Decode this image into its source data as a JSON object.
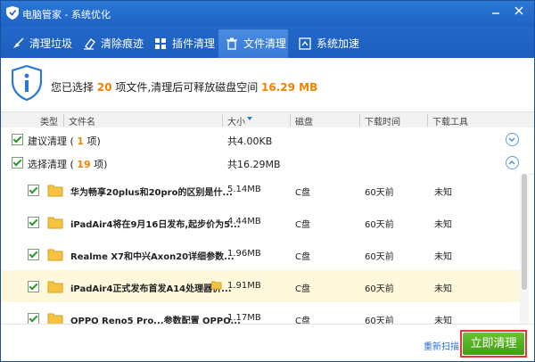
{
  "window": {
    "title": "电脑管家 - 系统优化"
  },
  "tabs": [
    {
      "label": "清理垃圾",
      "icon": "broom-icon"
    },
    {
      "label": "清除痕迹",
      "icon": "eraser-icon"
    },
    {
      "label": "插件清理",
      "icon": "plugin-grid-icon"
    },
    {
      "label": "文件清理",
      "icon": "trash-can-icon",
      "active": true
    },
    {
      "label": "系统加速",
      "icon": "speed-icon"
    }
  ],
  "summary": {
    "prefix": "您已选择",
    "count": "20",
    "middle": "项文件,清理后可释放磁盘空间",
    "size": "16.29 MB"
  },
  "columns": {
    "type": "类型",
    "name": "文件名",
    "size": "大小",
    "disk": "磁盘",
    "time": "下载时间",
    "tool": "下载工具"
  },
  "groups": [
    {
      "label_prefix": "建议清理 (",
      "count": "1",
      "label_suffix": "项)",
      "size": "共4.00KB",
      "expanded": false
    },
    {
      "label_prefix": "选择清理 (",
      "count": "19",
      "label_suffix": "项)",
      "size": "共16.29MB",
      "expanded": true
    }
  ],
  "files": [
    {
      "name": "华为畅享20plus和20pro的区别是什...",
      "size": "5.14MB",
      "disk": "C盘",
      "time": "60天前",
      "tool": "未知"
    },
    {
      "name": "iPadAir4将在9月16日发布,起步价为5...",
      "size": "4.44MB",
      "disk": "C盘",
      "time": "60天前",
      "tool": "未知"
    },
    {
      "name": "Realme X7和中兴Axon20详细参数...",
      "size": "1.96MB",
      "disk": "C盘",
      "time": "60天前",
      "tool": "未知"
    },
    {
      "name": "iPadAir4正式发布首发A14处理器价...",
      "size": "1.91MB",
      "disk": "C盘",
      "time": "60天前",
      "tool": "未知",
      "highlighted": true
    },
    {
      "name": "OPPO Reno5 Pro...参数配置 OPPO...",
      "size": "1.17MB",
      "disk": "C盘",
      "time": "60天前",
      "tool": "未知"
    }
  ],
  "footer": {
    "rescan": "重新扫描",
    "clean": "立即清理"
  },
  "colors": {
    "titlebar": "#1e63c4",
    "accent": "#f08300",
    "clean_button": "#4fb01f",
    "highlight_row": "#fdf8dc"
  }
}
